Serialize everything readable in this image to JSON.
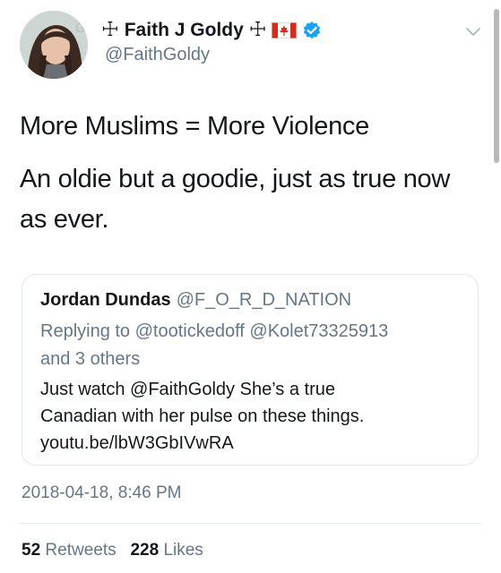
{
  "author": {
    "avatar_icon": "profile-photo",
    "cross_symbol": "☩",
    "display_name": "Faith J Goldy",
    "flag_icon": "canada-flag-icon",
    "verified_icon": "verified-badge-icon",
    "handle": "@FaithGoldy"
  },
  "tweet": {
    "lines": [
      "More Muslims = More Violence",
      "An oldie but a goodie, just as true now",
      "as ever."
    ]
  },
  "quoted_tweet": {
    "name": "Jordan Dundas",
    "handle": "@F_O_R_D_NATION",
    "reply_lines": [
      "Replying to @tootickedoff @Kolet73325913",
      "and 3 others"
    ],
    "body_lines": [
      "Just watch @FaithGoldy She’s a true",
      "Canadian with her pulse on these things.",
      "youtu.be/lbW3GbIVwRA"
    ]
  },
  "timestamp": "2018-04-18, 8:46 PM",
  "stats": {
    "retweets_count": "52",
    "retweets_label": "Retweets",
    "likes_count": "228",
    "likes_label": "Likes"
  },
  "colors": {
    "text": "#14171a",
    "secondary_text": "#657786",
    "border": "#e1e8ed",
    "verified_blue": "#1da1f2",
    "flag_red": "#d52b1e"
  }
}
